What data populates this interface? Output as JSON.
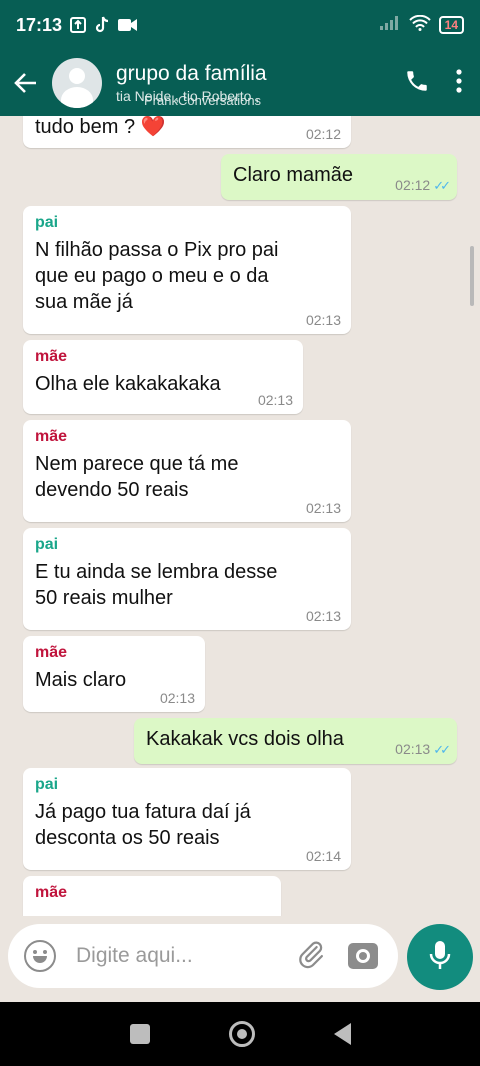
{
  "status_bar": {
    "time": "17:13",
    "battery": "14"
  },
  "header": {
    "group_name": "grupo da família",
    "members": "tia Neide , tio Roberto ,",
    "watermark": "PrankConversations"
  },
  "messages": [
    {
      "direction": "in",
      "sender": "",
      "text": "tudo bem ? ❤️",
      "time": "02:12"
    },
    {
      "direction": "out",
      "sender": "",
      "text": "Claro mamãe",
      "time": "02:12",
      "ticks": "✓✓"
    },
    {
      "direction": "in",
      "sender": "pai",
      "text": "N filhão passa o Pix pro pai que eu pago o meu e o da sua mãe já",
      "time": "02:13"
    },
    {
      "direction": "in",
      "sender": "mãe",
      "text": "Olha ele kakakakaka",
      "time": "02:13"
    },
    {
      "direction": "in",
      "sender": "mãe",
      "text": "Nem parece que tá me devendo 50 reais",
      "time": "02:13"
    },
    {
      "direction": "in",
      "sender": "pai",
      "text": "E tu ainda se lembra desse 50 reais mulher",
      "time": "02:13"
    },
    {
      "direction": "in",
      "sender": "mãe",
      "text": "Mais claro",
      "time": "02:13"
    },
    {
      "direction": "out",
      "sender": "",
      "text": "Kakakak vcs dois olha",
      "time": "02:13",
      "ticks": "✓✓"
    },
    {
      "direction": "in",
      "sender": "pai",
      "text": "Já pago tua fatura daí já desconta os 50 reais",
      "time": "02:14"
    },
    {
      "direction": "in",
      "sender": "mãe",
      "text": "",
      "time": ""
    }
  ],
  "input": {
    "placeholder": "Digite aqui..."
  },
  "colors": {
    "header": "#075e54",
    "outgoing": "#dcf8c6",
    "pai": "#1aa68a",
    "mae": "#c0143c",
    "mic": "#128c7e"
  }
}
